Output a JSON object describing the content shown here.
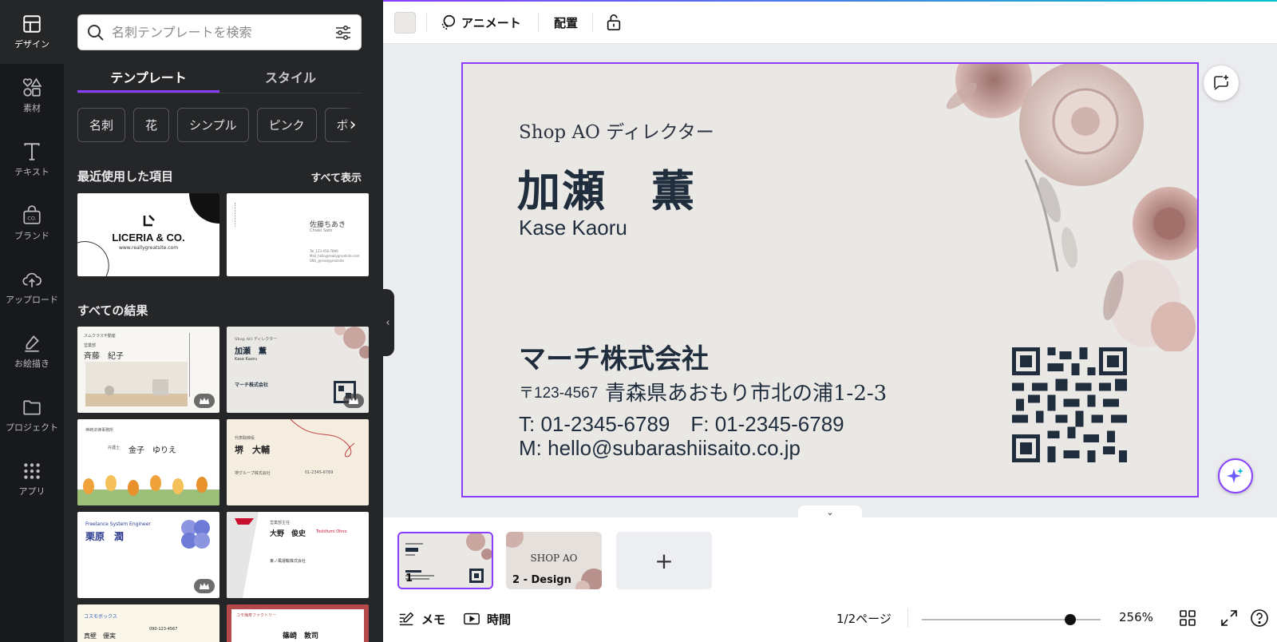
{
  "rail": [
    {
      "label": "デザイン",
      "icon": "layout-icon",
      "active": true
    },
    {
      "label": "素材",
      "icon": "shapes-icon"
    },
    {
      "label": "テキスト",
      "icon": "text-icon"
    },
    {
      "label": "ブランド",
      "icon": "brand-icon"
    },
    {
      "label": "アップロード",
      "icon": "upload-icon"
    },
    {
      "label": "お絵描き",
      "icon": "draw-icon"
    },
    {
      "label": "プロジェクト",
      "icon": "folder-icon"
    },
    {
      "label": "アプリ",
      "icon": "apps-icon"
    }
  ],
  "panel": {
    "search_placeholder": "名刺テンプレートを検索",
    "tabs": [
      "テンプレート",
      "スタイル"
    ],
    "chips": [
      "名刺",
      "花",
      "シンプル",
      "ピンク",
      "ポイント"
    ],
    "recent_title": "最近使用した項目",
    "see_all": "すべて表示",
    "all_results_title": "すべての結果",
    "recent": [
      {
        "brand": "LICERIA & CO.",
        "url": "www.reallygreatsite.com"
      },
      {
        "name": "佐藤ちあき",
        "name_en": "Chiaki Sato",
        "lines": [
          "Tel_123-456-7890",
          "Mail_hello@reallygreatsite.com",
          "SNS_@reallygreatsite"
        ]
      }
    ],
    "results": [
      {
        "company": "スムクラス不動産",
        "title": "営業部",
        "name": "斉藤　紀子",
        "premium": true
      },
      {
        "role": "Shop AO ディレクター",
        "name": "加瀬　薫",
        "name_en": "Kase Kaoru",
        "company": "マーチ株式会社",
        "premium": true
      },
      {
        "company": "神崎法律事務所",
        "title": "弁護士",
        "name": "金子　ゆりえ"
      },
      {
        "title": "代表取締役",
        "name": "堺　大輔",
        "company": "堺グループ株式会社",
        "phone": "01-2345-6789"
      },
      {
        "title": "Freelance System Engineer",
        "name": "栗原　潤",
        "premium": true
      },
      {
        "title": "営業部主任",
        "name": "大野　俊史",
        "name_en": "Toshifumi Ohno",
        "company": "東ノ風運輸株式会社"
      },
      {
        "company": "コスモボックス",
        "name": "真壁　優実",
        "phone": "090-123-4567"
      },
      {
        "company": "コモ梅寿ファクトリー",
        "name": "篠崎　敦司"
      }
    ]
  },
  "toolbar": {
    "color": "#ebe9e6",
    "animate": "アニメート",
    "arrange": "配置"
  },
  "card": {
    "role": "Shop AO ディレクター",
    "name_jp": "加瀬　薫",
    "name_en": "Kase Kaoru",
    "company": "マーチ株式会社",
    "postal": "〒123-4567",
    "address": "青森県あおもり市北の浦1-2-3",
    "tel": "T: 01-2345-6789　F: 01-2345-6789",
    "mail": "M: hello@subarashiisaito.co.jp"
  },
  "pages": [
    {
      "num": "1",
      "label": ""
    },
    {
      "num": "2",
      "label": "Design",
      "text": "SHOP AO"
    }
  ],
  "footer": {
    "notes": "メモ",
    "timer": "時間",
    "page_indicator": "1/2ページ",
    "zoom": "256%",
    "zoom_level": 0.83
  }
}
